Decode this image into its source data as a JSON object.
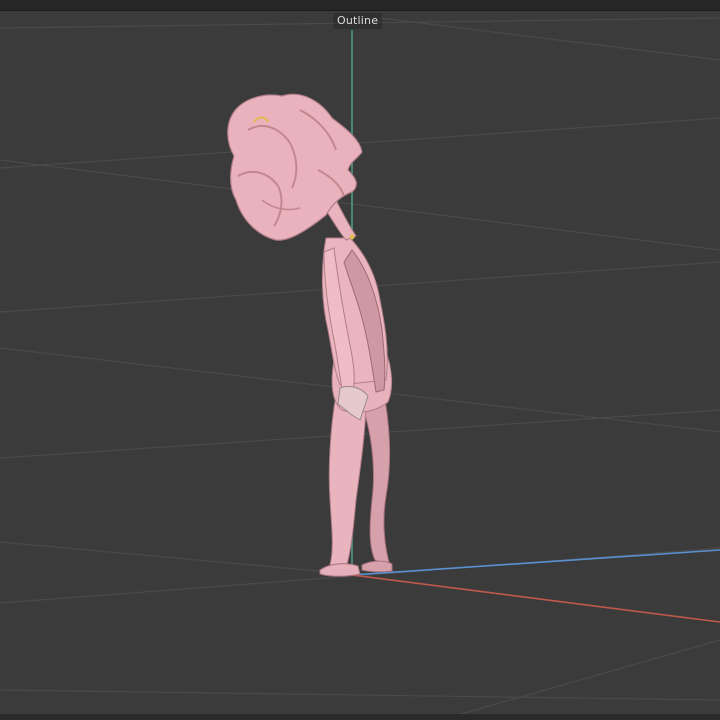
{
  "viewport": {
    "object_name": "Outline",
    "background_color": "#3b3b3b",
    "grid_color": "#4a4a4a",
    "axis_colors": {
      "x": "#c0584c",
      "y": "#5a8fd0",
      "z": "#4f9a82"
    },
    "model_color": "#e9b4bd"
  }
}
